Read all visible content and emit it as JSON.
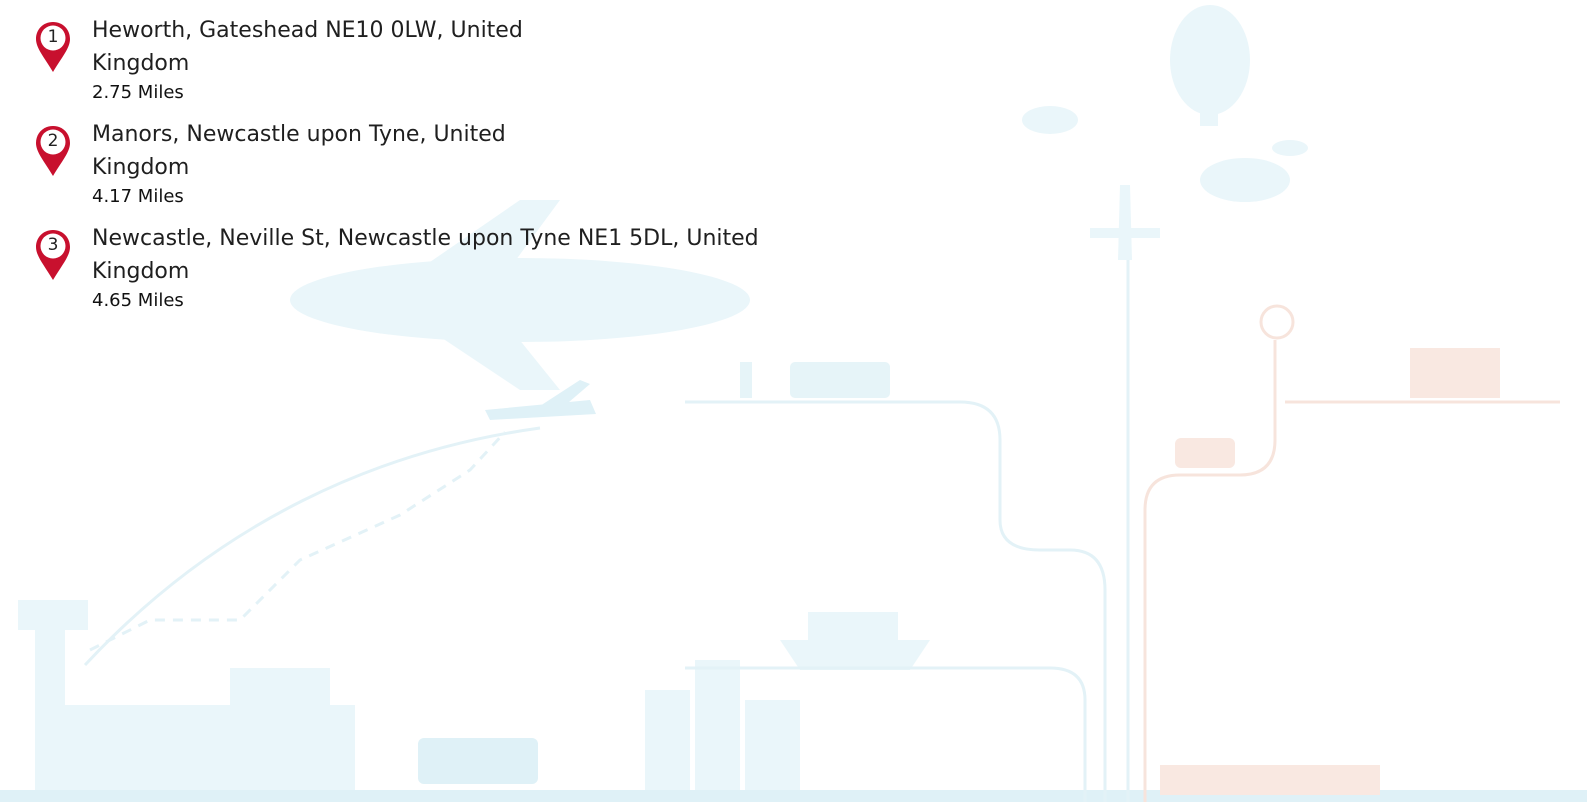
{
  "results": [
    {
      "index": "1",
      "address": "Heworth, Gateshead NE10 0LW, United Kingdom",
      "distance": "2.75 Miles"
    },
    {
      "index": "2",
      "address": "Manors, Newcastle upon Tyne, United Kingdom",
      "distance": "4.17 Miles"
    },
    {
      "index": "3",
      "address": "Newcastle, Neville St, Newcastle upon Tyne NE1 5DL, United Kingdom",
      "distance": "4.65 Miles"
    }
  ],
  "colors": {
    "pin": "#c8102e",
    "text": "#1f1f1f",
    "illustration_blue": "#d7eef6",
    "illustration_orange": "#f6ddd2"
  },
  "icons": {
    "pin": "map-pin-icon"
  }
}
